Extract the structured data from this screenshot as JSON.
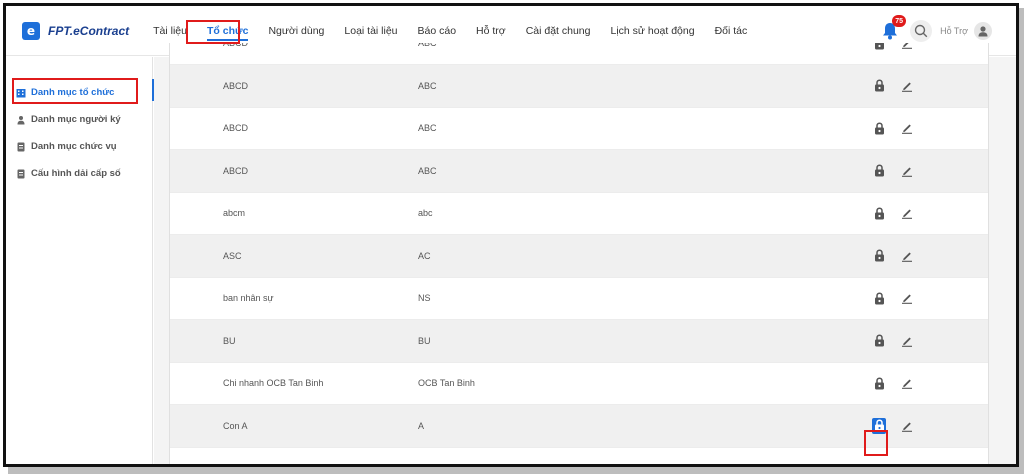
{
  "app": {
    "logo_letter": "e",
    "name": "FPT.eContract"
  },
  "nav": {
    "items": [
      {
        "label": "Tài liệu",
        "active": false
      },
      {
        "label": "Tổ chức",
        "active": true
      },
      {
        "label": "Người dùng",
        "active": false
      },
      {
        "label": "Loại tài liệu",
        "active": false
      },
      {
        "label": "Báo cáo",
        "active": false
      },
      {
        "label": "Hỗ trợ",
        "active": false
      },
      {
        "label": "Cài đặt chung",
        "active": false
      },
      {
        "label": "Lịch sử hoạt động",
        "active": false
      },
      {
        "label": "Đối tác",
        "active": false
      }
    ]
  },
  "header_right": {
    "notification_count": "75",
    "user_label": "Hỗ Trợ",
    "icons": [
      "bell-icon",
      "search-icon",
      "user-avatar-icon"
    ]
  },
  "sidebar": {
    "items": [
      {
        "label": "Danh mục tổ chức",
        "icon": "building-icon",
        "active": true
      },
      {
        "label": "Danh mục người ký",
        "icon": "person-icon",
        "active": false
      },
      {
        "label": "Danh mục chức vụ",
        "icon": "document-icon",
        "active": false
      },
      {
        "label": "Cấu hình dải cấp số",
        "icon": "document-icon",
        "active": false
      }
    ]
  },
  "table": {
    "rows": [
      {
        "name": "ABCD",
        "code": "ABC",
        "locked_highlight": false
      },
      {
        "name": "ABCD",
        "code": "ABC",
        "locked_highlight": false
      },
      {
        "name": "ABCD",
        "code": "ABC",
        "locked_highlight": false
      },
      {
        "name": "ABCD",
        "code": "ABC",
        "locked_highlight": false
      },
      {
        "name": "abcm",
        "code": "abc",
        "locked_highlight": false
      },
      {
        "name": "ASC",
        "code": "AC",
        "locked_highlight": false
      },
      {
        "name": "ban nhân sự",
        "code": "NS",
        "locked_highlight": false
      },
      {
        "name": "BU",
        "code": "BU",
        "locked_highlight": false
      },
      {
        "name": "Chi nhanh OCB Tan Binh",
        "code": "OCB Tan Binh",
        "locked_highlight": false
      },
      {
        "name": "Con A",
        "code": "A",
        "locked_highlight": true
      }
    ],
    "row_icons": [
      "lock-icon",
      "edit-icon"
    ]
  },
  "colors": {
    "accent": "#1e6fd9",
    "highlight_border": "#e01b1b",
    "badge": "#e01b1b"
  }
}
